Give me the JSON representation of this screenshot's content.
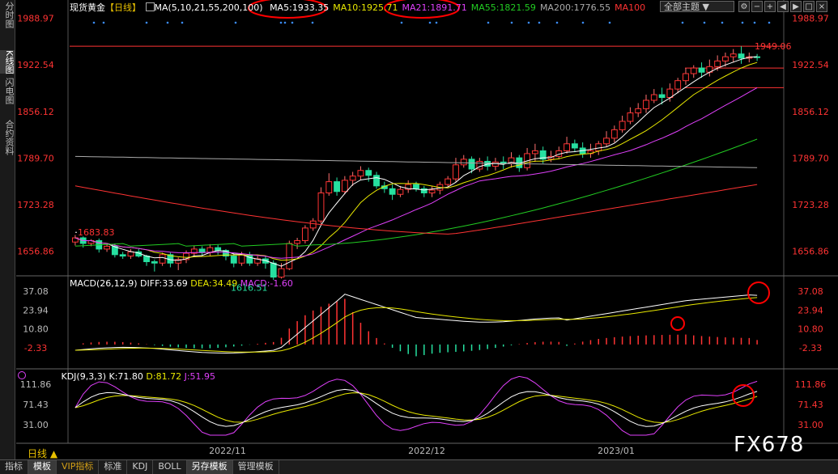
{
  "left_tabs": [
    {
      "label": "分时图",
      "active": false
    },
    {
      "label": "K线图",
      "active": true
    },
    {
      "label": "闪电图",
      "active": false
    },
    {
      "label": "合约资料",
      "active": false
    }
  ],
  "header": {
    "instrument": "现货黄金",
    "period_tag": "【日线】",
    "ma_params": "MA(5,10,21,55,200,100)",
    "ma_items": [
      {
        "label": "MA5:1933.35",
        "color": "#ffffff"
      },
      {
        "label": "MA10:1925.71",
        "color": "#e8e800"
      },
      {
        "label": "MA21:1891.71",
        "color": "#e040fb"
      },
      {
        "label": "MA55:1821.59",
        "color": "#22cc22"
      },
      {
        "label": "MA200:1776.55",
        "color": "#aaaaaa"
      },
      {
        "label": "MA100",
        "color": "#ff3333"
      }
    ],
    "theme_select": "全部主题",
    "theme_arrow": "▼"
  },
  "macd": {
    "params": "MACD(26,12,9)",
    "diff": "DIFF:33.69",
    "dea": "DEA:34.49",
    "macd": "MACD:-1.60"
  },
  "kdj": {
    "params": "KDJ(9,3,3)",
    "k": "K:71.80",
    "d": "D:81.72",
    "j": "J:51.95"
  },
  "bottom_tabs": [
    {
      "label": "指标",
      "active": false
    },
    {
      "label": "模板",
      "active": true
    },
    {
      "label": "VIP指标",
      "active": false
    },
    {
      "label": "标准",
      "active": false
    },
    {
      "label": "KDJ",
      "active": false
    },
    {
      "label": "BOLL",
      "active": false
    },
    {
      "label": "另存模板",
      "active": true
    },
    {
      "label": "管理模板",
      "active": false
    }
  ],
  "period_label": "日线 ▲",
  "watermark": "FX678",
  "colors": {
    "up": "#ff3333",
    "down": "#26e0a0",
    "ma5": "#ffffff",
    "ma10": "#e8e800",
    "ma21": "#e040fb",
    "ma55": "#22cc22",
    "ma200": "#aaaaaa",
    "ma100": "#ff3333",
    "axis_price": "#ff3333",
    "annotation_circle": "#ff0000"
  },
  "chart_data": [
    {
      "type": "candlestick",
      "title": "现货黄金【日线】",
      "x_ticks": [
        "2022/11",
        "2022/12",
        "2023/01"
      ],
      "y_ticks": [
        "1988.97",
        "1922.54",
        "1856.12",
        "1789.70",
        "1723.28",
        "1656.86"
      ],
      "ylim": [
        1623,
        1993
      ],
      "annotations": [
        {
          "text": "1683.83",
          "x_index": 0,
          "y": 1683.83
        },
        {
          "text": "1616.51",
          "x_index": 46,
          "y": 1616.51
        },
        {
          "text": "1949.06",
          "x_index": 139,
          "y": 1949.06
        }
      ],
      "horizontal_lines": [
        1949.06,
        1918,
        1890
      ],
      "candles": [
        [
          1670,
          1676,
          1665,
          1680
        ],
        [
          1676,
          1668,
          1662,
          1678
        ],
        [
          1668,
          1672,
          1664,
          1674
        ],
        [
          1672,
          1660,
          1655,
          1675
        ],
        [
          1660,
          1664,
          1656,
          1668
        ],
        [
          1664,
          1652,
          1648,
          1668
        ],
        [
          1652,
          1650,
          1646,
          1656
        ],
        [
          1650,
          1656,
          1646,
          1660
        ],
        [
          1656,
          1650,
          1648,
          1660
        ],
        [
          1650,
          1642,
          1636,
          1652
        ],
        [
          1642,
          1640,
          1628,
          1645
        ],
        [
          1640,
          1652,
          1636,
          1655
        ],
        [
          1652,
          1640,
          1634,
          1655
        ],
        [
          1640,
          1645,
          1630,
          1648
        ],
        [
          1645,
          1654,
          1640,
          1658
        ],
        [
          1654,
          1660,
          1650,
          1665
        ],
        [
          1660,
          1655,
          1650,
          1664
        ],
        [
          1655,
          1662,
          1650,
          1667
        ],
        [
          1662,
          1658,
          1652,
          1666
        ],
        [
          1658,
          1650,
          1644,
          1660
        ],
        [
          1650,
          1640,
          1634,
          1654
        ],
        [
          1640,
          1652,
          1636,
          1656
        ],
        [
          1652,
          1640,
          1636,
          1656
        ],
        [
          1640,
          1646,
          1636,
          1650
        ],
        [
          1646,
          1640,
          1632,
          1650
        ],
        [
          1640,
          1620,
          1616,
          1644
        ],
        [
          1620,
          1632,
          1618,
          1640
        ],
        [
          1632,
          1668,
          1630,
          1672
        ],
        [
          1668,
          1672,
          1660,
          1676
        ],
        [
          1672,
          1690,
          1668,
          1694
        ],
        [
          1690,
          1700,
          1686,
          1704
        ],
        [
          1700,
          1740,
          1696,
          1748
        ],
        [
          1740,
          1756,
          1736,
          1768
        ],
        [
          1756,
          1742,
          1736,
          1762
        ],
        [
          1742,
          1758,
          1738,
          1764
        ],
        [
          1758,
          1764,
          1750,
          1770
        ],
        [
          1764,
          1772,
          1758,
          1778
        ],
        [
          1772,
          1765,
          1756,
          1776
        ],
        [
          1765,
          1750,
          1746,
          1770
        ],
        [
          1750,
          1746,
          1740,
          1756
        ],
        [
          1746,
          1738,
          1730,
          1752
        ],
        [
          1738,
          1745,
          1734,
          1750
        ],
        [
          1745,
          1752,
          1740,
          1758
        ],
        [
          1752,
          1746,
          1742,
          1756
        ],
        [
          1746,
          1740,
          1734,
          1750
        ],
        [
          1740,
          1744,
          1734,
          1750
        ],
        [
          1744,
          1752,
          1738,
          1756
        ],
        [
          1752,
          1760,
          1748,
          1764
        ],
        [
          1760,
          1780,
          1756,
          1790
        ],
        [
          1780,
          1788,
          1776,
          1794
        ],
        [
          1788,
          1774,
          1768,
          1792
        ],
        [
          1774,
          1785,
          1770,
          1790
        ],
        [
          1785,
          1778,
          1772,
          1792
        ],
        [
          1778,
          1784,
          1772,
          1790
        ],
        [
          1784,
          1782,
          1774,
          1792
        ],
        [
          1782,
          1790,
          1776,
          1798
        ],
        [
          1790,
          1776,
          1770,
          1794
        ],
        [
          1776,
          1796,
          1772,
          1804
        ],
        [
          1796,
          1800,
          1784,
          1810
        ],
        [
          1800,
          1788,
          1782,
          1806
        ],
        [
          1788,
          1792,
          1784,
          1800
        ],
        [
          1792,
          1800,
          1788,
          1806
        ],
        [
          1800,
          1810,
          1796,
          1820
        ],
        [
          1810,
          1804,
          1798,
          1816
        ],
        [
          1804,
          1796,
          1790,
          1812
        ],
        [
          1796,
          1800,
          1790,
          1810
        ],
        [
          1800,
          1810,
          1794,
          1814
        ],
        [
          1810,
          1818,
          1806,
          1828
        ],
        [
          1818,
          1830,
          1812,
          1836
        ],
        [
          1830,
          1842,
          1826,
          1850
        ],
        [
          1842,
          1854,
          1838,
          1862
        ],
        [
          1854,
          1860,
          1848,
          1868
        ],
        [
          1860,
          1872,
          1854,
          1880
        ],
        [
          1872,
          1880,
          1868,
          1888
        ],
        [
          1880,
          1876,
          1866,
          1890
        ],
        [
          1876,
          1888,
          1870,
          1896
        ],
        [
          1888,
          1900,
          1882,
          1904
        ],
        [
          1900,
          1910,
          1894,
          1918
        ],
        [
          1910,
          1918,
          1904,
          1922
        ],
        [
          1918,
          1912,
          1904,
          1926
        ],
        [
          1912,
          1920,
          1906,
          1930
        ],
        [
          1920,
          1928,
          1914,
          1936
        ],
        [
          1928,
          1934,
          1920,
          1940
        ],
        [
          1934,
          1938,
          1926,
          1945
        ],
        [
          1938,
          1932,
          1924,
          1949
        ],
        [
          1932,
          1934,
          1926,
          1940
        ],
        [
          1934,
          1933,
          1928,
          1938
        ]
      ]
    },
    {
      "type": "line+bar",
      "title": "MACD(26,12,9)",
      "y_ticks": [
        "37.08",
        "23.94",
        "10.80",
        "-2.33"
      ],
      "ylim": [
        -5,
        42
      ],
      "diff_latest": 33.69,
      "dea_latest": 34.49,
      "macd_latest": -1.6
    },
    {
      "type": "line",
      "title": "KDJ(9,3,3)",
      "y_ticks": [
        "111.86",
        "71.43",
        "31.00"
      ],
      "ylim": [
        10,
        130
      ],
      "k_latest": 71.8,
      "d_latest": 81.72,
      "j_latest": 51.95
    }
  ]
}
